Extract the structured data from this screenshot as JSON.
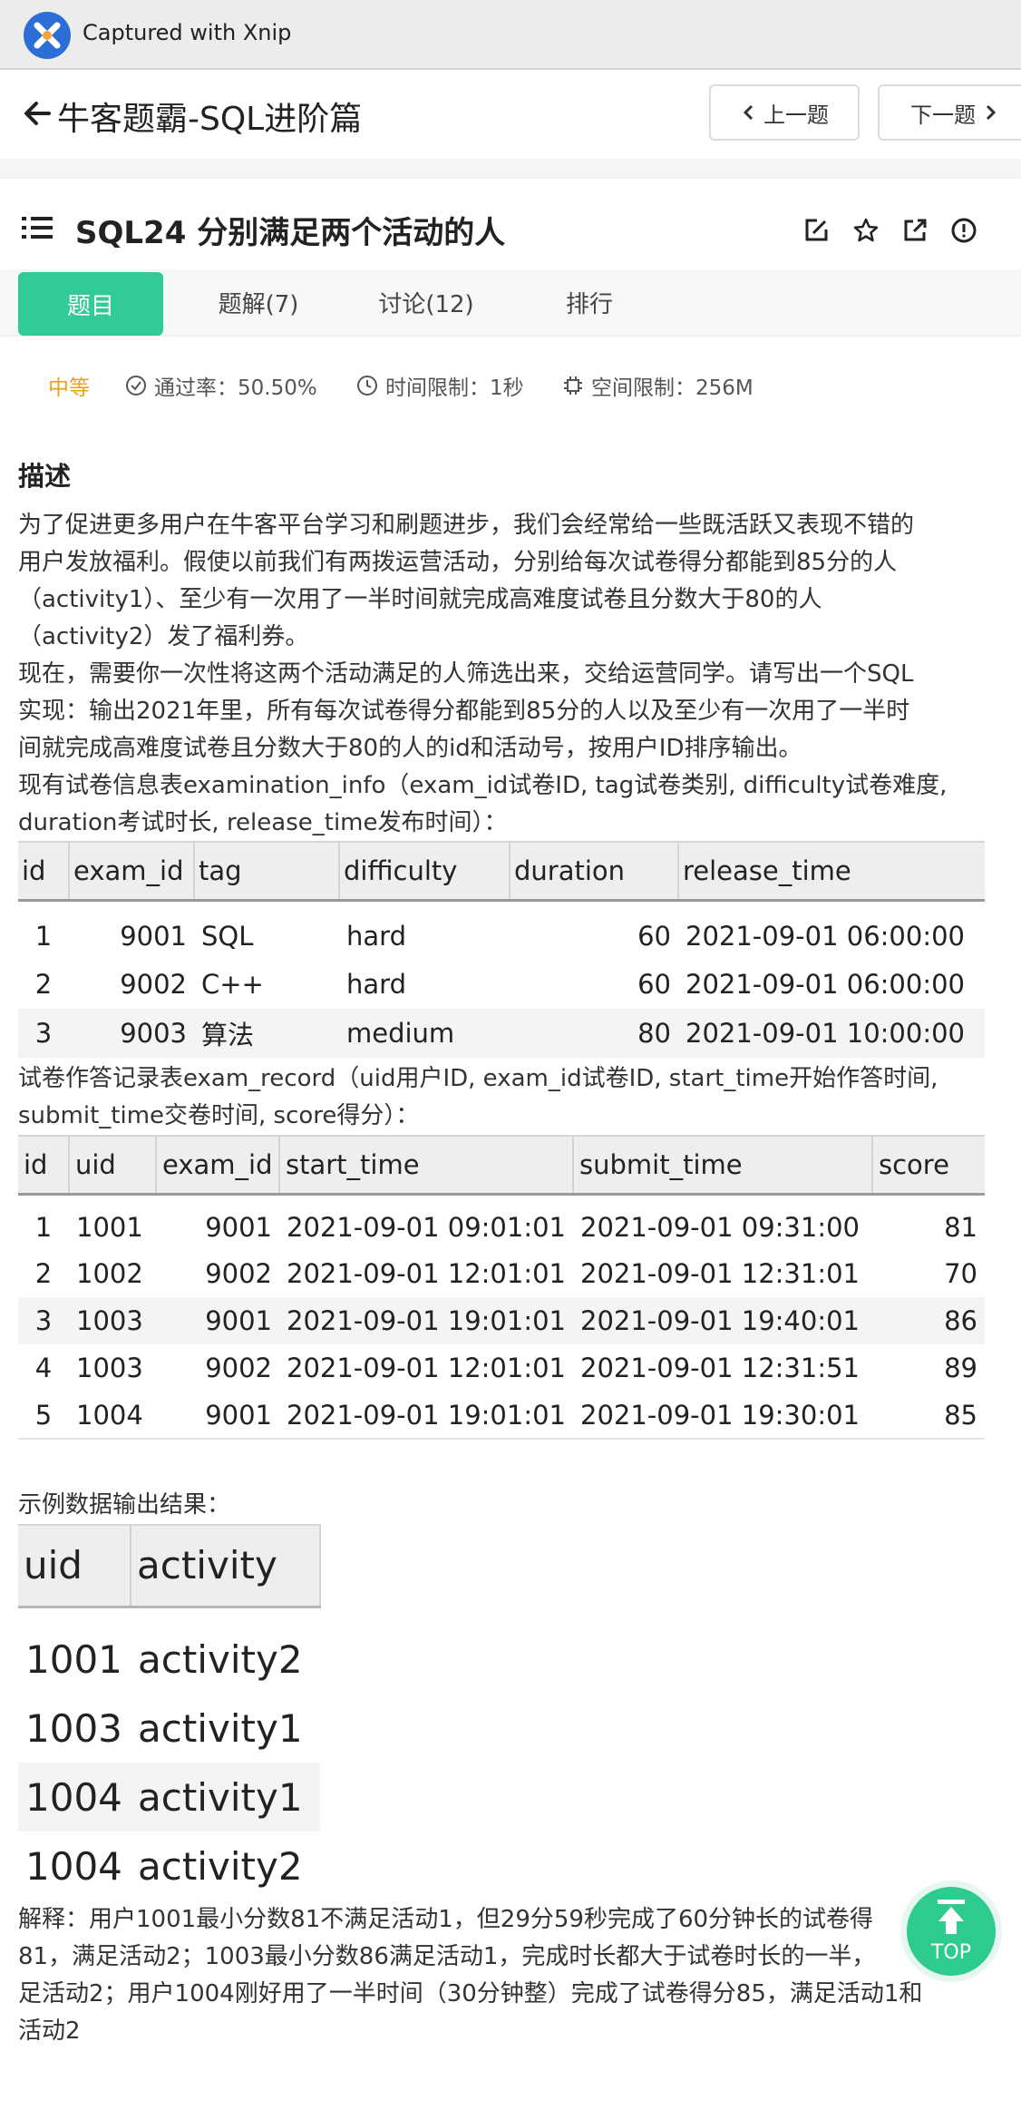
{
  "capture_bar": {
    "label": "Captured with Xnip"
  },
  "header": {
    "title": "牛客题霸-SQL进阶篇",
    "prev_label": "上一题",
    "next_label": "下一题"
  },
  "problem": {
    "title": "SQL24  分别满足两个活动的人"
  },
  "tabs": [
    {
      "label": "题目",
      "active": true
    },
    {
      "label": "题解(7)",
      "active": false
    },
    {
      "label": "讨论(12)",
      "active": false
    },
    {
      "label": "排行",
      "active": false
    }
  ],
  "meta": {
    "difficulty": "中等",
    "pass_rate": "通过率：50.50%",
    "time_limit": "时间限制：1秒",
    "space_limit": "空间限制：256M"
  },
  "description": {
    "heading": "描述",
    "intro_lines": [
      "为了促进更多用户在牛客平台学习和刷题进步，我们会经常给一些既活跃又表现不错的",
      "用户发放福利。假使以前我们有两拨运营活动，分别给每次试卷得分都能到85分的人",
      "（activity1）、至少有一次用了一半时间就完成高难度试卷且分数大于80的人",
      "（activity2）发了福利券。"
    ],
    "task_lines": [
      "现在，需要你一次性将这两个活动满足的人筛选出来，交给运营同学。请写出一个SQL",
      "实现：输出2021年里，所有每次试卷得分都能到85分的人以及至少有一次用了一半时",
      "间就完成高难度试卷且分数大于80的人的id和活动号，按用户ID排序输出。"
    ],
    "exam_info_lines": [
      "现有试卷信息表examination_info（exam_id试卷ID, tag试卷类别, difficulty试卷难度,",
      "duration考试时长, release_time发布时间）："
    ]
  },
  "examination_info": {
    "columns": [
      "id",
      "exam_id",
      "tag",
      "difficulty",
      "duration",
      "release_time"
    ],
    "rows": [
      [
        "1",
        "9001",
        "SQL",
        "hard",
        "60",
        "2021-09-01 06:00:00"
      ],
      [
        "2",
        "9002",
        "C++",
        "hard",
        "60",
        "2021-09-01 06:00:00"
      ],
      [
        "3",
        "9003",
        "算法",
        "medium",
        "80",
        "2021-09-01 10:00:00"
      ]
    ]
  },
  "exam_record_intro_lines": [
    "试卷作答记录表exam_record（uid用户ID, exam_id试卷ID, start_time开始作答时间,",
    "submit_time交卷时间, score得分）："
  ],
  "exam_record": {
    "columns": [
      "id",
      "uid",
      "exam_id",
      "start_time",
      "submit_time",
      "score"
    ],
    "rows": [
      [
        "1",
        "1001",
        "9001",
        "2021-09-01 09:01:01",
        "2021-09-01 09:31:00",
        "81"
      ],
      [
        "2",
        "1002",
        "9002",
        "2021-09-01 12:01:01",
        "2021-09-01 12:31:01",
        "70"
      ],
      [
        "3",
        "1003",
        "9001",
        "2021-09-01 19:01:01",
        "2021-09-01 19:40:01",
        "86"
      ],
      [
        "4",
        "1003",
        "9002",
        "2021-09-01 12:01:01",
        "2021-09-01 12:31:51",
        "89"
      ],
      [
        "5",
        "1004",
        "9001",
        "2021-09-01 19:01:01",
        "2021-09-01 19:30:01",
        "85"
      ]
    ]
  },
  "sample_output_label": "示例数据输出结果：",
  "sample_output": {
    "columns": [
      "uid",
      "activity"
    ],
    "rows": [
      [
        "1001",
        "activity2"
      ],
      [
        "1003",
        "activity1"
      ],
      [
        "1004",
        "activity1"
      ],
      [
        "1004",
        "activity2"
      ]
    ]
  },
  "explanation_lines": [
    "解释：用户1001最小分数81不满足活动1，但29分59秒完成了60分钟长的试卷得",
    "81，满足活动2；1003最小分数86满足活动1，完成时长都大于试卷时长的一半，",
    "足活动2；用户1004刚好用了一半时间（30分钟整）完成了试卷得分85，满足活动1和",
    "活动2"
  ],
  "top_button": {
    "label": "TOP"
  },
  "colors": {
    "accent": "#32ca99",
    "difficulty": "#e8a317",
    "xnip_blue": "#2b6fd6"
  }
}
